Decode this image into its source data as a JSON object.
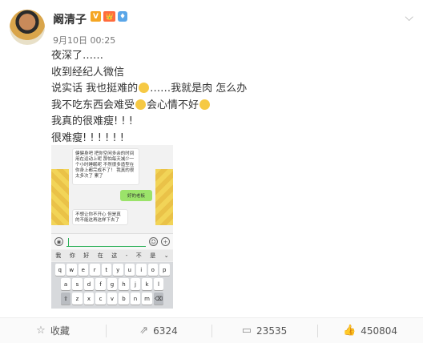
{
  "post": {
    "username": "阚清子",
    "badges": {
      "verified": "V",
      "vip": "👑",
      "level": "♦"
    },
    "timestamp": "9月10日 00:25",
    "lines": [
      "夜深了……",
      "收到经纪人微信",
      "说实话 我也挺难的",
      "……我就是肉 怎么办",
      "我不吃东西会难受",
      "会心情不好",
      "我真的很难瘦! ! !",
      "很难瘦! ! ! ! ! !"
    ]
  },
  "screenshot": {
    "msg1": "健健身吧 把你空闲多余的时间用在运动上呢 那怕每天减少一个小时睡眠呢 不然很多造型在你身上都完成不了！ 我真的很太多次了 累了",
    "msg2": "好的老板",
    "msg3": "不想让你不开心 但是真的不能这再这样下去了",
    "candidates": [
      "我",
      "你",
      "好",
      "在",
      "这",
      "-",
      "不",
      "是"
    ],
    "row1": [
      "q",
      "w",
      "e",
      "r",
      "t",
      "y",
      "u",
      "i",
      "o",
      "p"
    ],
    "row2": [
      "a",
      "s",
      "d",
      "f",
      "g",
      "h",
      "j",
      "k",
      "l"
    ],
    "row3": [
      "z",
      "x",
      "c",
      "v",
      "b",
      "n",
      "m"
    ]
  },
  "footer": {
    "favorite_label": "收藏",
    "repost_count": "6324",
    "comment_count": "23535",
    "like_count": "450804"
  }
}
